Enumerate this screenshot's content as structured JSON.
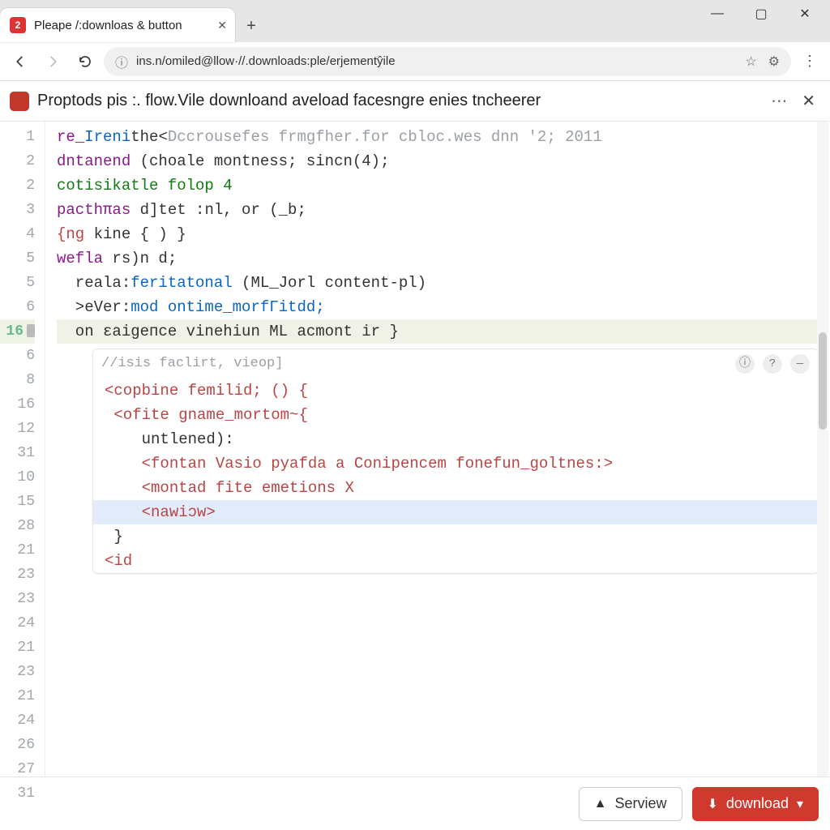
{
  "browser": {
    "tab_badge": "2",
    "tab_title": "Pleape /:downloas & button",
    "plus_label": "+",
    "win_min": "—",
    "win_max": "▢",
    "win_close": "✕"
  },
  "navbar": {
    "url": "ins.n/omiled@llow·//.downloads:ple/erjementŷile",
    "star": "☆",
    "settings": "⚙",
    "kebab": "⋮",
    "search_icon": "ⓘ"
  },
  "infobar": {
    "message": "Proptods pis :. flow.Vile downloand aveload facesngre enies tncheerer",
    "more": "⋯",
    "dismiss": "✕"
  },
  "gutter": {
    "numbers": [
      "1",
      "2",
      "2",
      "3",
      "4",
      "5",
      "5",
      "6",
      "16",
      "6",
      "8",
      "16",
      "12",
      "31",
      "10",
      "15",
      "28",
      "21",
      "23",
      "23",
      "24",
      "21",
      "23",
      "21",
      "24",
      "26",
      "27",
      "31"
    ]
  },
  "code": {
    "l1a": "re_",
    "l1b": "Ireni",
    "l1c": "the<",
    "l1d": "Dccrousefes frmgfher.for cbloc.wes dnn '2; 2011",
    "l2a": "dntanend ",
    "l2b": "(choale montness; sincn(4);",
    "l3": "cotisikatle folop 4",
    "l4a": "pacthπas ",
    "l4b": "d]tet :nl, or (_b;",
    "l5a": "{ng ",
    "l5b": "kine { ) }",
    "l6a": "wefla ",
    "l6b": "rs)n d;",
    "l7a": "  reala:",
    "l7b": "feritatonal ",
    "l7c": "(ML_Jorl content-pl)",
    "l8a": "  >eVer:",
    "l8b": "mod ontime_morfΓitdd;",
    "l9": "  on ɛaigeпce vinehiun ML acmont ir }",
    "sub_header": "//isis faclirt, vieop]",
    "s1": "<copbine femilid; () {",
    "s2": " <ofite gname_mortom~{",
    "s3": "    untlened):",
    "s4": "    <fontan Vasio pyafda a Conipencem fonefun_goltnes:>",
    "s5": "    <montad fite emetions X",
    "s6": "    <nawiɔw>",
    "s7": " }",
    "s8": "<id"
  },
  "footer": {
    "secondary_label": "Serview",
    "primary_label": "download"
  }
}
